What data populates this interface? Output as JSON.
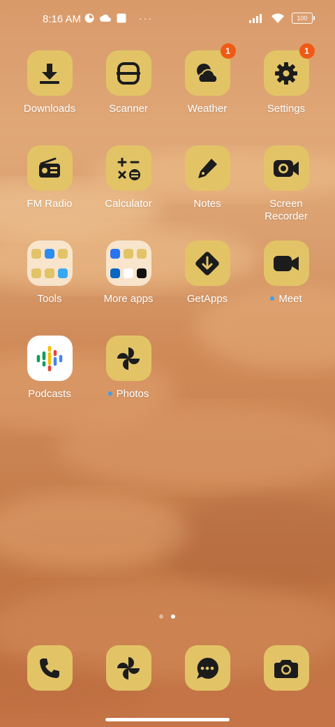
{
  "status": {
    "time": "8:16 AM",
    "battery": "100"
  },
  "apps": [
    {
      "name": "Downloads",
      "icon": "download-icon"
    },
    {
      "name": "Scanner",
      "icon": "scanner-icon"
    },
    {
      "name": "Weather",
      "icon": "weather-cloud-icon",
      "badge": "1"
    },
    {
      "name": "Settings",
      "icon": "gear-icon",
      "badge": "1"
    },
    {
      "name": "FM Radio",
      "icon": "radio-icon"
    },
    {
      "name": "Calculator",
      "icon": "calculator-icon"
    },
    {
      "name": "Notes",
      "icon": "pen-icon"
    },
    {
      "name": "Screen\nRecorder",
      "icon": "camcorder-icon"
    },
    {
      "name": "Tools",
      "icon": "folder-icon"
    },
    {
      "name": "More apps",
      "icon": "folder-icon"
    },
    {
      "name": "GetApps",
      "icon": "getapps-icon"
    },
    {
      "name": "Meet",
      "icon": "video-icon",
      "new_dot": true
    },
    {
      "name": "Podcasts",
      "icon": "podcasts-icon"
    },
    {
      "name": "Photos",
      "icon": "pinwheel-icon",
      "new_dot": true
    }
  ],
  "dock": [
    {
      "name": "Phone",
      "icon": "phone-icon"
    },
    {
      "name": "Gallery",
      "icon": "pinwheel-icon"
    },
    {
      "name": "Messages",
      "icon": "message-bubble-icon"
    },
    {
      "name": "Camera",
      "icon": "camera-icon"
    }
  ],
  "pager": {
    "pages": 2,
    "current": 2
  },
  "colors": {
    "tile": "#e2c467",
    "glyph": "#1c1c1c",
    "badge": "#f05a15",
    "new_dot": "#3ba0f0"
  }
}
